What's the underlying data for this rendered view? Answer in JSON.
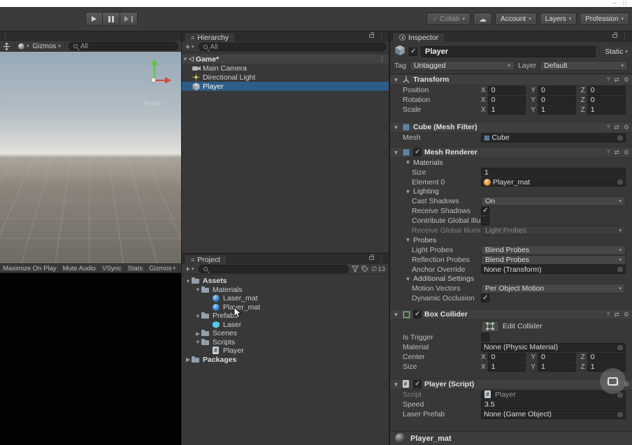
{
  "titlebar": {
    "minimize": "–",
    "maximize": "□"
  },
  "toolbar": {
    "collab_label": "Collab",
    "account_label": "Account",
    "layers_label": "Layers",
    "layout_label": "Profession"
  },
  "scene_view": {
    "gizmos_label": "Gizmos",
    "search_value": "All",
    "persp_label": "Persp"
  },
  "game_view": {
    "buttons": [
      "Maximize On Play",
      "Mute Audio",
      "VSync",
      "Stats",
      "Gizmos"
    ]
  },
  "hierarchy": {
    "tab_title": "Hierarchy",
    "search_value": "All",
    "scene_name": "Game*",
    "items": [
      {
        "label": "Main Camera",
        "selected": false
      },
      {
        "label": "Directional Light",
        "selected": false
      },
      {
        "label": "Player",
        "selected": true
      }
    ]
  },
  "project": {
    "tab_title": "Project",
    "search_value": "",
    "hidden_count": "13",
    "tree": [
      {
        "label": "Assets",
        "depth": 0,
        "arrow": "▼",
        "bold": true,
        "kind": "folder",
        "icon_name": "folder-icon"
      },
      {
        "label": "Materials",
        "depth": 1,
        "arrow": "▼",
        "bold": false,
        "kind": "folder",
        "icon_name": "folder-icon"
      },
      {
        "label": "Laser_mat",
        "depth": 2,
        "arrow": "",
        "bold": false,
        "kind": "material",
        "icon_name": "material-sphere-icon"
      },
      {
        "label": "Player_mat",
        "depth": 2,
        "arrow": "",
        "bold": false,
        "kind": "material",
        "icon_name": "material-sphere-icon"
      },
      {
        "label": "Prefabs",
        "depth": 1,
        "arrow": "▼",
        "bold": false,
        "kind": "folder",
        "icon_name": "folder-icon"
      },
      {
        "label": "Laser",
        "depth": 2,
        "arrow": "",
        "bold": false,
        "kind": "prefab",
        "icon_name": "prefab-cube-icon"
      },
      {
        "label": "Scenes",
        "depth": 1,
        "arrow": "▶",
        "bold": false,
        "kind": "folder",
        "icon_name": "folder-icon"
      },
      {
        "label": "Scripts",
        "depth": 1,
        "arrow": "▼",
        "bold": false,
        "kind": "folder",
        "icon_name": "folder-icon"
      },
      {
        "label": "Player",
        "depth": 2,
        "arrow": "",
        "bold": false,
        "kind": "script",
        "icon_name": "script-icon"
      },
      {
        "label": "Packages",
        "depth": 0,
        "arrow": "▶",
        "bold": true,
        "kind": "folder",
        "icon_name": "folder-icon"
      }
    ]
  },
  "inspector": {
    "tab_title": "Inspector",
    "axes": {
      "x": "X",
      "y": "Y",
      "z": "Z"
    },
    "header": {
      "enabled": true,
      "name": "Player",
      "static_label": "Static",
      "tag_label": "Tag",
      "tag_value": "Untagged",
      "layer_label": "Layer",
      "layer_value": "Default"
    },
    "transform": {
      "title": "Transform",
      "rows": [
        {
          "label": "Position",
          "x": "0",
          "y": "0",
          "z": "0"
        },
        {
          "label": "Rotation",
          "x": "0",
          "y": "0",
          "z": "0"
        },
        {
          "label": "Scale",
          "x": "1",
          "y": "1",
          "z": "1"
        }
      ]
    },
    "mesh_filter": {
      "title": "Cube (Mesh Filter)",
      "mesh_label": "Mesh",
      "mesh_value": "Cube"
    },
    "mesh_renderer": {
      "title": "Mesh Renderer",
      "enabled": true,
      "materials_label": "Materials",
      "size_label": "Size",
      "size_value": "1",
      "element0_label": "Element 0",
      "element0_value": "Player_mat",
      "lighting_label": "Lighting",
      "cast_shadows_label": "Cast Shadows",
      "cast_shadows_value": "On",
      "receive_shadows_label": "Receive Shadows",
      "receive_shadows_checked": true,
      "contribute_gi_label": "Contribute Global Illuminat",
      "contribute_gi_checked": false,
      "receive_gi_label": "Receive Global Illuminatio",
      "receive_gi_value": "Light Probes",
      "probes_label": "Probes",
      "light_probes_label": "Light Probes",
      "light_probes_value": "Blend Probes",
      "reflection_probes_label": "Reflection Probes",
      "reflection_probes_value": "Blend Probes",
      "anchor_label": "Anchor Override",
      "anchor_value": "None (Transform)",
      "additional_label": "Additional Settings",
      "motion_vectors_label": "Motion Vectors",
      "motion_vectors_value": "Per Object Motion",
      "dynamic_occlusion_label": "Dynamic Occlusion",
      "dynamic_occlusion_checked": true
    },
    "box_collider": {
      "title": "Box Collider",
      "enabled": true,
      "edit_collider_label": "Edit Collider",
      "is_trigger_label": "Is Trigger",
      "is_trigger_checked": false,
      "material_label": "Material",
      "material_value": "None (Physic Material)",
      "center_label": "Center",
      "center": {
        "x": "0",
        "y": "0",
        "z": "0"
      },
      "size_label": "Size",
      "size": {
        "x": "1",
        "y": "1",
        "z": "1"
      }
    },
    "player_script": {
      "title": "Player (Script)",
      "enabled": true,
      "script_label": "Script",
      "script_value": "Player",
      "speed_label": "Speed",
      "speed_value": "3.5",
      "laser_prefab_label": "Laser Prefab",
      "laser_prefab_value": "None (Game Object)"
    },
    "material_footer": {
      "name": "Player_mat"
    }
  },
  "colors": {
    "selection_blue": "#2d5d87",
    "panel_bg": "#383838",
    "field_bg": "#262626"
  }
}
